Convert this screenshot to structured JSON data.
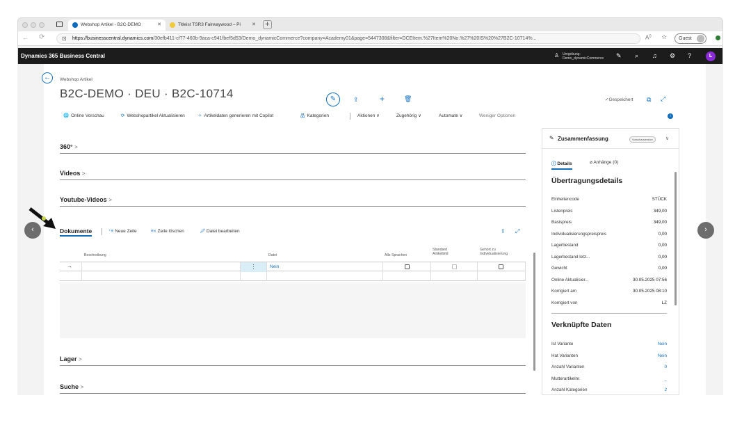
{
  "browser": {
    "tabs": [
      {
        "label": "Webshop Artikel - B2C-DEMO"
      },
      {
        "label": "Titleist TSR3 Fairwaywood – Pi"
      }
    ],
    "url_host": "https://businesscentral.dynamics.com",
    "url_path": "/30efb411-cf77-460b-9aca-c941fbef5d53/Demo_dynamicCommerce?company=Academy01&page=5447308&filter=DCEItem.%27Item%20No.%27%20IS%20%27B2C-10714%...",
    "guest_label": "Guest"
  },
  "app": {
    "title": "Dynamics 365 Business Central",
    "env_label": "Umgebung:",
    "env_value": "Demo_dynamicCommerce",
    "avatar": "L"
  },
  "record": {
    "breadcrumb": "Webshop Artikel",
    "title": "B2C-DEMO · DEU · B2C-10714",
    "saved": "✓Gespeichert"
  },
  "actions": {
    "online_preview": "Online Vorschau",
    "update": "Webshopartikel Aktualisieren",
    "copilot": "Artikeldaten generieren mit Copilot",
    "categories": "Kategorien",
    "aktionen": "Aktionen",
    "zugehoerig": "Zugehörig",
    "automate": "Automate",
    "fewer": "Weniger Optionen"
  },
  "sections": {
    "s360": "360°",
    "videos": "Videos",
    "youtube": "Youtube-Videos",
    "lager": "Lager",
    "suche": "Suche"
  },
  "documents": {
    "title": "Dokumente",
    "new_row": "Neue Zeile",
    "delete_row": "Zeile löschen",
    "edit_file": "Datei bearbeiten",
    "columns": {
      "beschreibung": "Beschreibung",
      "datei": "Datei",
      "alle_sprachen": "Alle Sprachen",
      "standard_1": "Standard",
      "standard_2": "Artikelbild",
      "gehoert_1": "Gehört zu",
      "gehoert_2": "Individualisierung"
    },
    "row1_datei": "Nein"
  },
  "factbox": {
    "title": "Zusammenfassung",
    "badge": "Vorschauversion",
    "tab_details": "Details",
    "tab_attachments": "Anhänge (0)",
    "section1": "Übertragungsdetails",
    "details": [
      {
        "k": "Einheitencode",
        "v": "STÜCK"
      },
      {
        "k": "Listenpreis",
        "v": "349,00"
      },
      {
        "k": "Basispreis",
        "v": "349,00"
      },
      {
        "k": "Individualisierungspreispreis",
        "v": "0,00"
      },
      {
        "k": "Lagerbestand",
        "v": "0,00"
      },
      {
        "k": "Lagerbestand letz...",
        "v": "0,00"
      },
      {
        "k": "Gewicht",
        "v": "0,00"
      },
      {
        "k": "Online Aktualisier...",
        "v": "30.05.2025 07:56"
      },
      {
        "k": "Korrigiert am",
        "v": "30.05.2025 08:10"
      },
      {
        "k": "Korrigiert von",
        "v": "LZ"
      }
    ],
    "section2": "Verknüpfte Daten",
    "linked": [
      {
        "k": "Ist Variante",
        "v": "Nein"
      },
      {
        "k": "Hat Varianten",
        "v": "Nein"
      },
      {
        "k": "Anzahl Varianten",
        "v": "0"
      },
      {
        "k": "Mutterartikelnr.",
        "v": "_"
      },
      {
        "k": "Anzahl Kategorien",
        "v": "2"
      }
    ]
  },
  "colors": {
    "accent": "#0f6cbd",
    "appbar": "#1c1c1c",
    "avatar": "#8a2bd8"
  }
}
